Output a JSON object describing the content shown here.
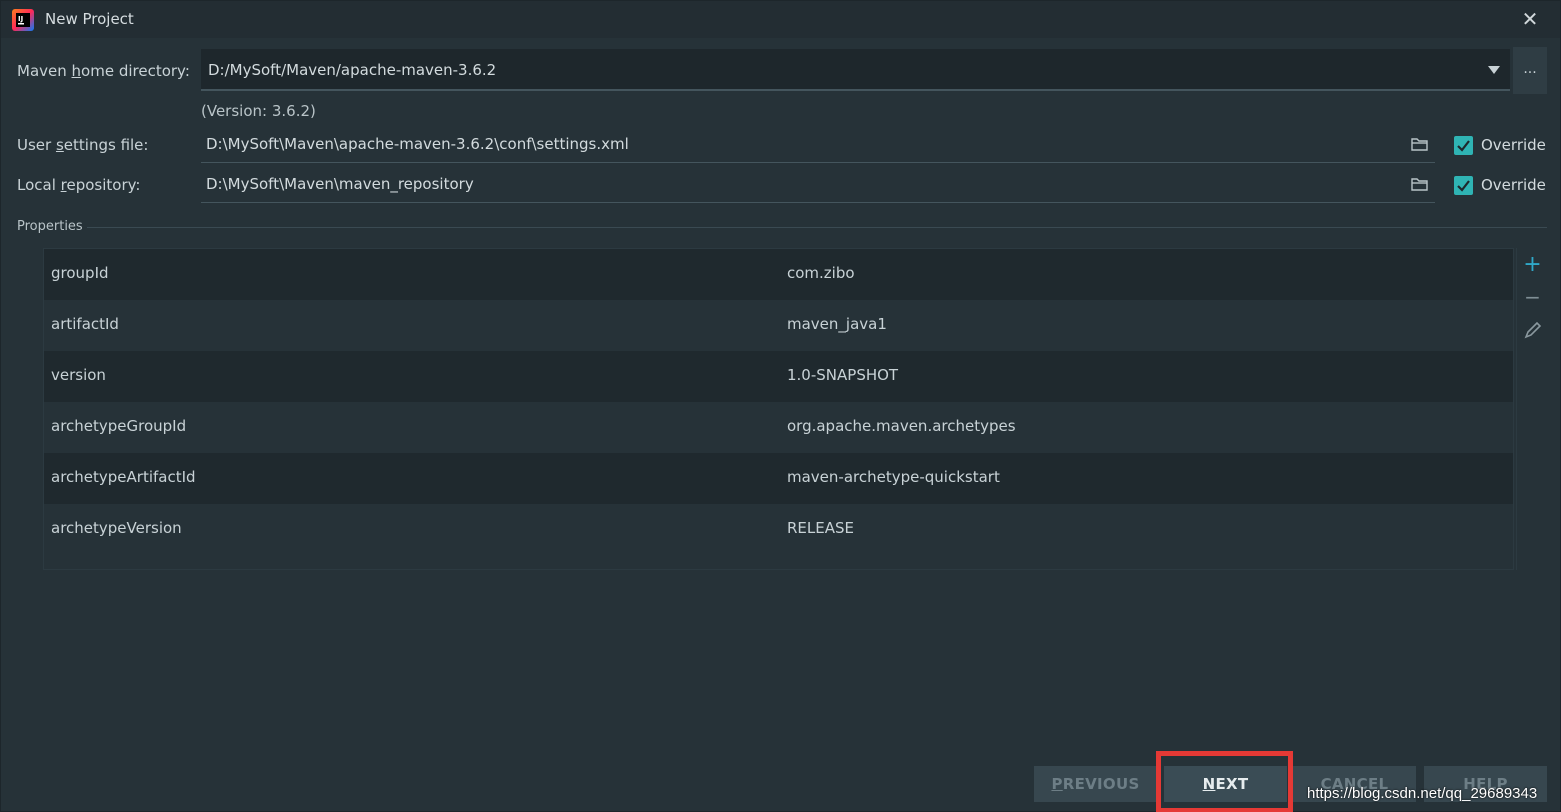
{
  "window": {
    "title": "New Project",
    "close_glyph": "✕"
  },
  "maven": {
    "home_label_pre": "Maven ",
    "home_label_ul": "h",
    "home_label_post": "ome directory:",
    "home_value": "D:/MySoft/Maven/apache-maven-3.6.2",
    "browse_glyph": "...",
    "version_note": "(Version: 3.6.2)",
    "settings_label_pre": "User ",
    "settings_label_ul": "s",
    "settings_label_post": "ettings file:",
    "settings_value": "D:\\MySoft\\Maven\\apache-maven-3.6.2\\conf\\settings.xml",
    "settings_override": "Override",
    "repo_label_pre": "Local ",
    "repo_label_ul": "r",
    "repo_label_post": "epository:",
    "repo_value": "D:\\MySoft\\Maven\\maven_repository",
    "repo_override": "Override"
  },
  "properties": {
    "title": "Properties",
    "rows": [
      {
        "key": "groupId",
        "value": "com.zibo"
      },
      {
        "key": "artifactId",
        "value": "maven_java1"
      },
      {
        "key": "version",
        "value": "1.0-SNAPSHOT"
      },
      {
        "key": "archetypeGroupId",
        "value": "org.apache.maven.archetypes"
      },
      {
        "key": "archetypeArtifactId",
        "value": "maven-archetype-quickstart"
      },
      {
        "key": "archetypeVersion",
        "value": "RELEASE"
      }
    ],
    "tools": {
      "add": "+",
      "remove": "−"
    }
  },
  "footer": {
    "previous_ul": "P",
    "previous_rest": "REVIOUS",
    "next_ul": "N",
    "next_rest": "EXT",
    "cancel": "CANCEL",
    "help": "HELP"
  },
  "watermark": "https://blog.csdn.net/qq_29689343",
  "colors": {
    "background": "#263238",
    "accent": "#2fb4b4",
    "highlight": "#e53935"
  }
}
